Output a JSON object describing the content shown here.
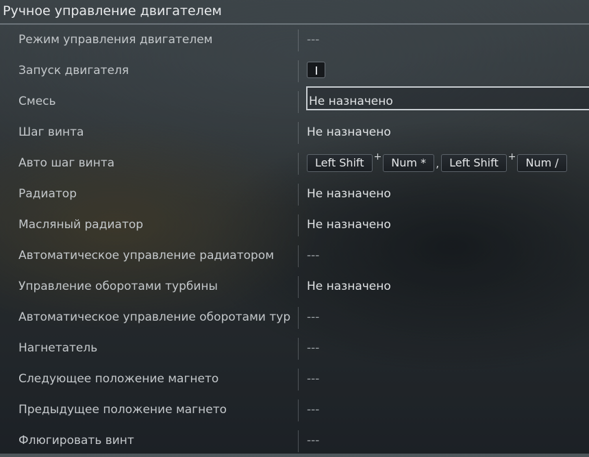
{
  "header": {
    "title": "Ручное управление двигателем"
  },
  "rows": [
    {
      "label": "Режим управления двигателем",
      "value": "---"
    },
    {
      "label": "Запуск двигателя",
      "icon": "key-bar-icon"
    },
    {
      "label": "Смесь",
      "value": "Не назначено"
    },
    {
      "label": "Шаг винта",
      "value": "Не назначено"
    },
    {
      "label": "Авто шаг винта",
      "keys": [
        "Left Shift",
        "Num *",
        "Left Shift",
        "Num /"
      ],
      "plus": "+",
      "comma": ","
    },
    {
      "label": "Радиатор",
      "value": "Не назначено"
    },
    {
      "label": "Масляный радиатор",
      "value": "Не назначено"
    },
    {
      "label": "Автоматическое управление радиатором",
      "value": "---"
    },
    {
      "label": "Управление оборотами турбины",
      "value": "Не назначено"
    },
    {
      "label": "Автоматическое управление оборотами турбины",
      "value": "---"
    },
    {
      "label": "Нагнетатель",
      "value": "---"
    },
    {
      "label": "Следующее положение магнето",
      "value": "---"
    },
    {
      "label": "Предыдущее положение магнето",
      "value": "---"
    },
    {
      "label": "Флюгировать винт",
      "value": "---"
    }
  ]
}
